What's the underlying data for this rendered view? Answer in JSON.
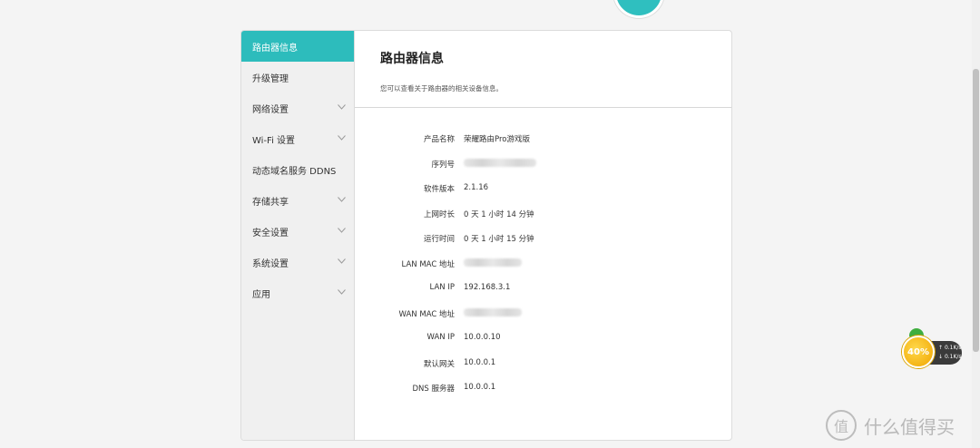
{
  "sidebar": {
    "items": [
      {
        "label": "路由器信息",
        "active": true,
        "expandable": false
      },
      {
        "label": "升级管理",
        "active": false,
        "expandable": false
      },
      {
        "label": "网络设置",
        "active": false,
        "expandable": true
      },
      {
        "label": "Wi-Fi 设置",
        "active": false,
        "expandable": true
      },
      {
        "label": "动态域名服务 DDNS",
        "active": false,
        "expandable": false
      },
      {
        "label": "存储共享",
        "active": false,
        "expandable": true
      },
      {
        "label": "安全设置",
        "active": false,
        "expandable": true
      },
      {
        "label": "系统设置",
        "active": false,
        "expandable": true
      },
      {
        "label": "应用",
        "active": false,
        "expandable": true
      }
    ]
  },
  "main": {
    "title": "路由器信息",
    "description": "您可以查看关于路由器的相关设备信息。",
    "info": [
      {
        "key": "产品名称",
        "value": "荣耀路由Pro游戏版",
        "redacted": false
      },
      {
        "key": "序列号",
        "value": "",
        "redacted": true
      },
      {
        "key": "软件版本",
        "value": "2.1.16",
        "redacted": false
      },
      {
        "key": "上网时长",
        "value": "0 天 1 小时 14 分钟",
        "redacted": false
      },
      {
        "key": "运行时间",
        "value": "0 天 1 小时 15 分钟",
        "redacted": false
      },
      {
        "key": "LAN MAC 地址",
        "value": "",
        "redacted": true
      },
      {
        "key": "LAN IP",
        "value": "192.168.3.1",
        "redacted": false
      },
      {
        "key": "WAN MAC 地址",
        "value": "",
        "redacted": true
      },
      {
        "key": "WAN IP",
        "value": "10.0.0.10",
        "redacted": false
      },
      {
        "key": "默认网关",
        "value": "10.0.0.1",
        "redacted": false
      },
      {
        "key": "DNS 服务器",
        "value": "10.0.0.1",
        "redacted": false
      }
    ]
  },
  "speed_widget": {
    "percent": "40%",
    "upload": "0.1K/s",
    "download": "0.1K/s"
  },
  "watermark": {
    "text": "什么值得买",
    "icon": "值"
  },
  "colors": {
    "accent": "#2dbcbc"
  }
}
